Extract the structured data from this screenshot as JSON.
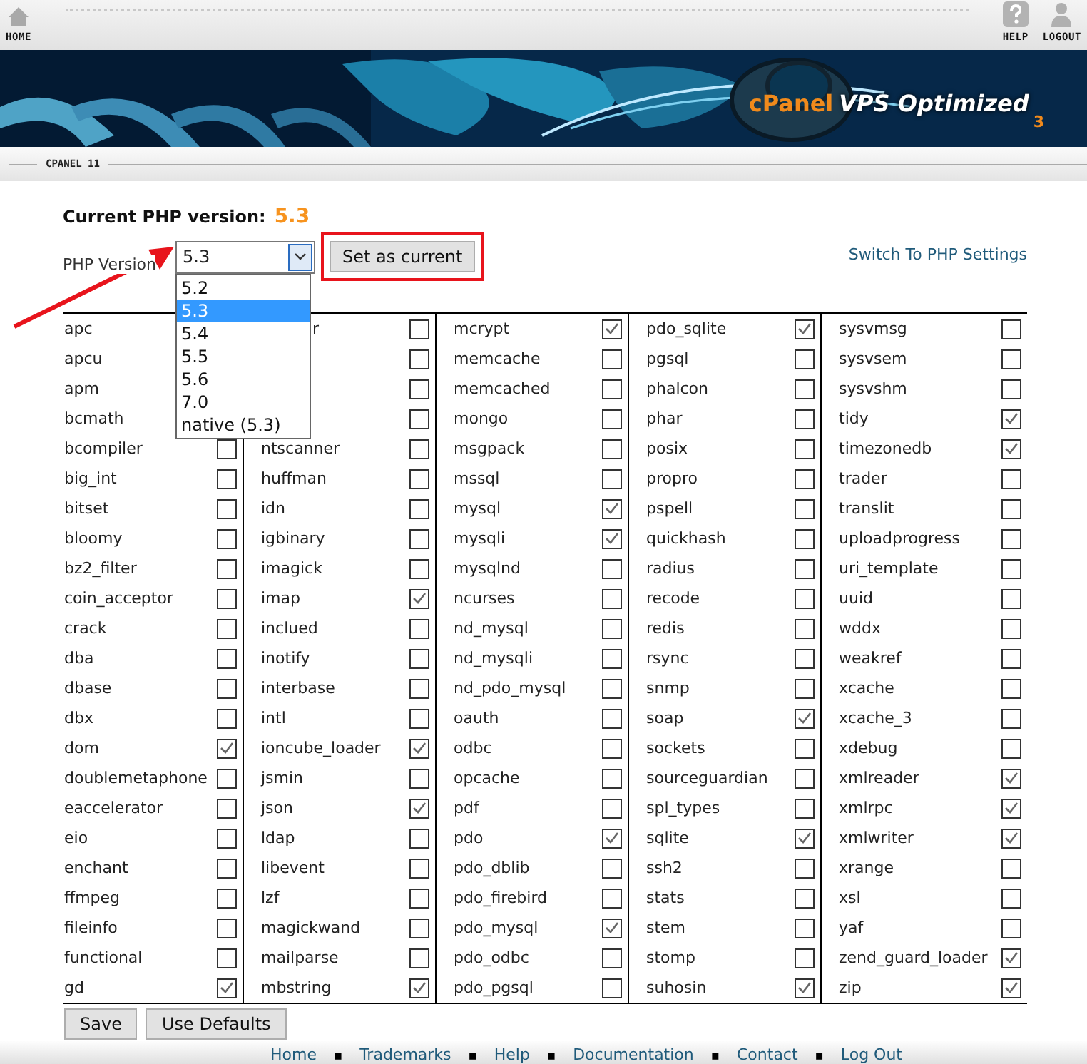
{
  "top_bar": {
    "items": [
      {
        "label": "HOME",
        "kind": "home"
      },
      {
        "label": "HELP",
        "kind": "help"
      },
      {
        "label": "LOGOUT",
        "kind": "logout"
      }
    ]
  },
  "banner": {
    "brand": "cPanel",
    "product": "VPS Optimized",
    "version": "3"
  },
  "section_label": "CPANEL 11",
  "current_version": {
    "label": "Current PHP version:",
    "value": "5.3"
  },
  "version_select": {
    "label": "PHP Version",
    "value": "5.3",
    "expanded": true,
    "options": [
      {
        "label": "5.2",
        "selected": false
      },
      {
        "label": "5.3",
        "selected": true
      },
      {
        "label": "5.4",
        "selected": false
      },
      {
        "label": "5.5",
        "selected": false
      },
      {
        "label": "5.6",
        "selected": false
      },
      {
        "label": "7.0",
        "selected": false
      },
      {
        "label": "native (5.3)",
        "selected": false
      }
    ]
  },
  "set_button": {
    "label": "Set as current",
    "highlighted": true
  },
  "switch_link": "Switch To PHP Settings",
  "extensions": [
    [
      {
        "name": "apc"
      },
      {
        "name": "apcu"
      },
      {
        "name": "apm"
      },
      {
        "name": "bcmath"
      },
      {
        "name": "bcompiler",
        "checked": false
      },
      {
        "name": "big_int",
        "checked": false
      },
      {
        "name": "bitset",
        "checked": false
      },
      {
        "name": "bloomy",
        "checked": false
      },
      {
        "name": "bz2_filter",
        "checked": false
      },
      {
        "name": "coin_acceptor",
        "checked": false
      },
      {
        "name": "crack",
        "checked": false
      },
      {
        "name": "dba",
        "checked": false
      },
      {
        "name": "dbase",
        "checked": false
      },
      {
        "name": "dbx",
        "checked": false
      },
      {
        "name": "dom",
        "checked": true
      },
      {
        "name": "doublemetaphone",
        "checked": false
      },
      {
        "name": "eaccelerator",
        "checked": false
      },
      {
        "name": "eio",
        "checked": false
      },
      {
        "name": "enchant",
        "checked": false
      },
      {
        "name": "ffmpeg",
        "checked": false
      },
      {
        "name": "fileinfo",
        "checked": false
      },
      {
        "name": "functional",
        "checked": false
      },
      {
        "name": "gd",
        "checked": true
      }
    ],
    [
      {
        "name": "r",
        "kind": "covered",
        "checked": false
      },
      {
        "checked": false
      },
      {
        "checked": false
      },
      {
        "checked": false
      },
      {
        "name": "ntscanner",
        "checked": false
      },
      {
        "name": "huffman",
        "checked": false
      },
      {
        "name": "idn",
        "checked": false
      },
      {
        "name": "igbinary",
        "checked": false
      },
      {
        "name": "imagick",
        "checked": false
      },
      {
        "name": "imap",
        "checked": true
      },
      {
        "name": "inclued",
        "checked": false
      },
      {
        "name": "inotify",
        "checked": false
      },
      {
        "name": "interbase",
        "checked": false
      },
      {
        "name": "intl",
        "checked": false
      },
      {
        "name": "ioncube_loader",
        "checked": true
      },
      {
        "name": "jsmin",
        "checked": false
      },
      {
        "name": "json",
        "checked": true
      },
      {
        "name": "ldap",
        "checked": false
      },
      {
        "name": "libevent",
        "checked": false
      },
      {
        "name": "lzf",
        "checked": false
      },
      {
        "name": "magickwand",
        "checked": false
      },
      {
        "name": "mailparse",
        "checked": false
      },
      {
        "name": "mbstring",
        "checked": true
      }
    ],
    [
      {
        "name": "mcrypt",
        "checked": true
      },
      {
        "name": "memcache",
        "checked": false
      },
      {
        "name": "memcached",
        "checked": false
      },
      {
        "name": "mongo",
        "checked": false
      },
      {
        "name": "msgpack",
        "checked": false
      },
      {
        "name": "mssql",
        "checked": false
      },
      {
        "name": "mysql",
        "checked": true
      },
      {
        "name": "mysqli",
        "checked": true
      },
      {
        "name": "mysqlnd",
        "checked": false
      },
      {
        "name": "ncurses",
        "checked": false
      },
      {
        "name": "nd_mysql",
        "checked": false
      },
      {
        "name": "nd_mysqli",
        "checked": false
      },
      {
        "name": "nd_pdo_mysql",
        "checked": false
      },
      {
        "name": "oauth",
        "checked": false
      },
      {
        "name": "odbc",
        "checked": false
      },
      {
        "name": "opcache",
        "checked": false
      },
      {
        "name": "pdf",
        "checked": false
      },
      {
        "name": "pdo",
        "checked": true
      },
      {
        "name": "pdo_dblib",
        "checked": false
      },
      {
        "name": "pdo_firebird",
        "checked": false
      },
      {
        "name": "pdo_mysql",
        "checked": true
      },
      {
        "name": "pdo_odbc",
        "checked": false
      },
      {
        "name": "pdo_pgsql",
        "checked": false
      }
    ],
    [
      {
        "name": "pdo_sqlite",
        "checked": true
      },
      {
        "name": "pgsql",
        "checked": false
      },
      {
        "name": "phalcon",
        "checked": false
      },
      {
        "name": "phar",
        "checked": false
      },
      {
        "name": "posix",
        "checked": false
      },
      {
        "name": "propro",
        "checked": false
      },
      {
        "name": "pspell",
        "checked": false
      },
      {
        "name": "quickhash",
        "checked": false
      },
      {
        "name": "radius",
        "checked": false
      },
      {
        "name": "recode",
        "checked": false
      },
      {
        "name": "redis",
        "checked": false
      },
      {
        "name": "rsync",
        "checked": false
      },
      {
        "name": "snmp",
        "checked": false
      },
      {
        "name": "soap",
        "checked": true
      },
      {
        "name": "sockets",
        "checked": false
      },
      {
        "name": "sourceguardian",
        "checked": false
      },
      {
        "name": "spl_types",
        "checked": false
      },
      {
        "name": "sqlite",
        "checked": true
      },
      {
        "name": "ssh2",
        "checked": false
      },
      {
        "name": "stats",
        "checked": false
      },
      {
        "name": "stem",
        "checked": false
      },
      {
        "name": "stomp",
        "checked": false
      },
      {
        "name": "suhosin",
        "checked": true
      }
    ],
    [
      {
        "name": "sysvmsg",
        "checked": false
      },
      {
        "name": "sysvsem",
        "checked": false
      },
      {
        "name": "sysvshm",
        "checked": false
      },
      {
        "name": "tidy",
        "checked": true
      },
      {
        "name": "timezonedb",
        "checked": true
      },
      {
        "name": "trader",
        "checked": false
      },
      {
        "name": "translit",
        "checked": false
      },
      {
        "name": "uploadprogress",
        "checked": false
      },
      {
        "name": "uri_template",
        "checked": false
      },
      {
        "name": "uuid",
        "checked": false
      },
      {
        "name": "wddx",
        "checked": false
      },
      {
        "name": "weakref",
        "checked": false
      },
      {
        "name": "xcache",
        "checked": false
      },
      {
        "name": "xcache_3",
        "checked": false
      },
      {
        "name": "xdebug",
        "checked": false
      },
      {
        "name": "xmlreader",
        "checked": true
      },
      {
        "name": "xmlrpc",
        "checked": true
      },
      {
        "name": "xmlwriter",
        "checked": true
      },
      {
        "name": "xrange",
        "checked": false
      },
      {
        "name": "xsl",
        "checked": false
      },
      {
        "name": "yaf",
        "checked": false
      },
      {
        "name": "zend_guard_loader",
        "checked": true
      },
      {
        "name": "zip",
        "checked": true
      }
    ]
  ],
  "buttons": [
    "Save",
    "Use Defaults"
  ],
  "footer_links": [
    "Home",
    "Trademarks",
    "Help",
    "Documentation",
    "Contact",
    "Log Out"
  ],
  "separator": "▪"
}
